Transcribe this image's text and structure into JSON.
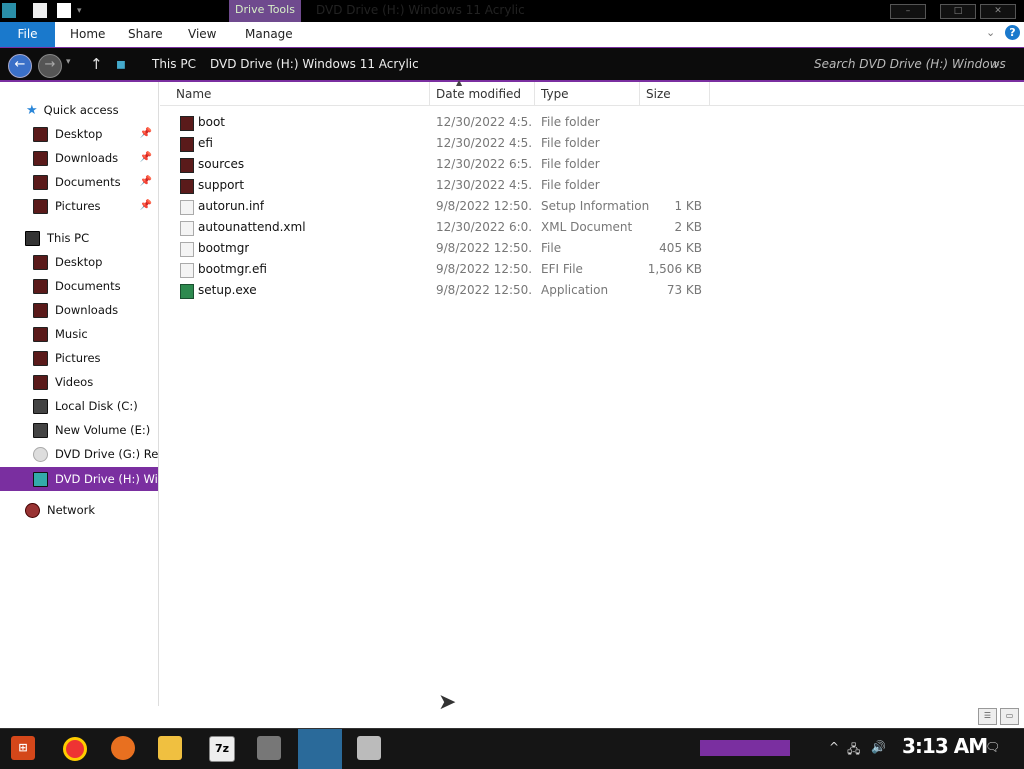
{
  "window": {
    "title": "DVD Drive (H:) Windows 11 Acrylic",
    "context_tab": "Drive Tools",
    "minimize": "–",
    "maximize": "□",
    "close": "✕"
  },
  "ribbon": {
    "tabs": [
      "File",
      "Home",
      "Share",
      "View",
      "Manage"
    ],
    "expand": "⌄",
    "help": "?"
  },
  "address": {
    "back": "←",
    "forward": "→",
    "dropdown": "▾",
    "up": "↑",
    "breadcrumbs": [
      "This PC",
      "DVD Drive (H:) Windows 11 Acrylic"
    ],
    "search_placeholder": "Search DVD Drive (H:) Windows ...",
    "search_icon": "⌕"
  },
  "nav": {
    "quick_access": "Quick access",
    "quick_items": [
      "Desktop",
      "Downloads",
      "Documents",
      "Pictures"
    ],
    "this_pc": "This PC",
    "pc_items": [
      "Desktop",
      "Documents",
      "Downloads",
      "Music",
      "Pictures",
      "Videos",
      "Local Disk (C:)",
      "New Volume (E:)",
      "DVD Drive (G:) Revi",
      "DVD Drive (H:) Wir"
    ],
    "network": "Network",
    "pin": "📌"
  },
  "columns": {
    "name": "Name",
    "date": "Date modified",
    "type": "Type",
    "size": "Size"
  },
  "files": [
    {
      "name": "boot",
      "date": "12/30/2022 4:5...",
      "type": "File folder",
      "size": "",
      "icon": "folder-icon"
    },
    {
      "name": "efi",
      "date": "12/30/2022 4:5...",
      "type": "File folder",
      "size": "",
      "icon": "folder-icon"
    },
    {
      "name": "sources",
      "date": "12/30/2022 6:5...",
      "type": "File folder",
      "size": "",
      "icon": "folder-icon"
    },
    {
      "name": "support",
      "date": "12/30/2022 4:5...",
      "type": "File folder",
      "size": "",
      "icon": "folder-icon"
    },
    {
      "name": "autorun.inf",
      "date": "9/8/2022 12:50...",
      "type": "Setup Information",
      "size": "1 KB",
      "icon": "settings-file-icon"
    },
    {
      "name": "autounattend.xml",
      "date": "12/30/2022 6:0...",
      "type": "XML Document",
      "size": "2 KB",
      "icon": "xml-file-icon"
    },
    {
      "name": "bootmgr",
      "date": "9/8/2022 12:50...",
      "type": "File",
      "size": "405 KB",
      "icon": "file-icon"
    },
    {
      "name": "bootmgr.efi",
      "date": "9/8/2022 12:50...",
      "type": "EFI File",
      "size": "1,506 KB",
      "icon": "file-icon"
    },
    {
      "name": "setup.exe",
      "date": "9/8/2022 12:50...",
      "type": "Application",
      "size": "73 KB",
      "icon": "setup-exe-icon"
    }
  ],
  "view_buttons": [
    "☰",
    "▭"
  ],
  "taskbar": {
    "seven_zip": "7z",
    "clock": "3:13 AM",
    "tray_chevron": "^",
    "network_icon": "🖧",
    "volume_icon": "🔊",
    "notification_icon": "🗨"
  }
}
